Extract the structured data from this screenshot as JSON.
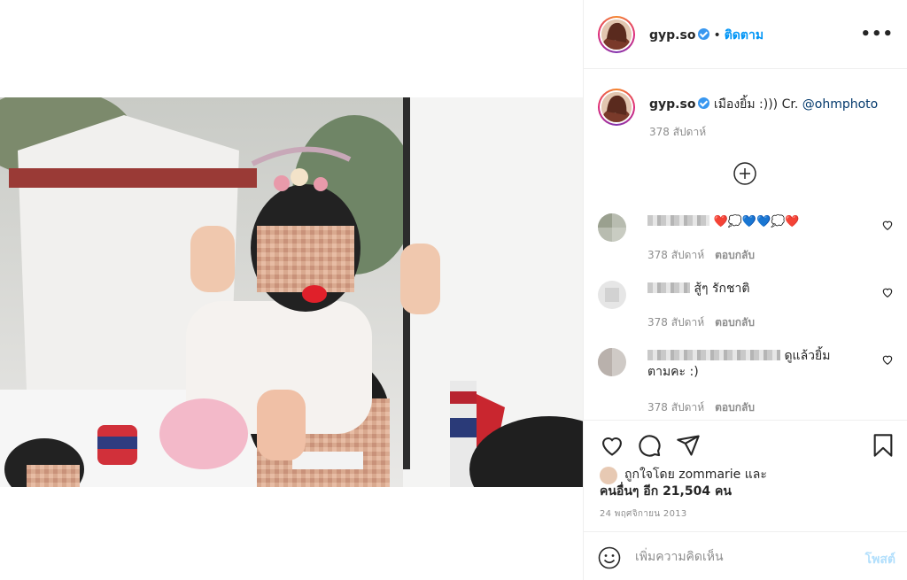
{
  "post": {
    "username": "gyp.so",
    "follow_label": "ติดตาม",
    "more_icon": "more-horizontal-icon",
    "caption_text": "เมืองยิ้ม :))) Cr.",
    "caption_mention": "@ohmphoto",
    "caption_time": "378 สัปดาห์"
  },
  "comments": [
    {
      "text": "❤️💭💙💙💭❤️",
      "time": "378 สัปดาห์",
      "reply_label": "ตอบกลับ"
    },
    {
      "text": "สู้ๆ รักชาติ",
      "time": "378 สัปดาห์",
      "reply_label": "ตอบกลับ"
    },
    {
      "text": "ดูแล้วยิ้มตามคะ :)",
      "time": "378 สัปดาห์",
      "reply_label": "ตอบกลับ"
    }
  ],
  "likes": {
    "line1": "ถูกใจโดย zommarie และ",
    "line2": "คนอื่นๆ อีก 21,504 คน"
  },
  "date": "24 พฤศจิกายน 2013",
  "composer": {
    "placeholder": "เพิ่มความคิดเห็น",
    "post_label": "โพสต์"
  },
  "colors": {
    "link": "#0095f6",
    "muted": "#8e8e8e",
    "post_button_disabled": "#b2dffc"
  }
}
